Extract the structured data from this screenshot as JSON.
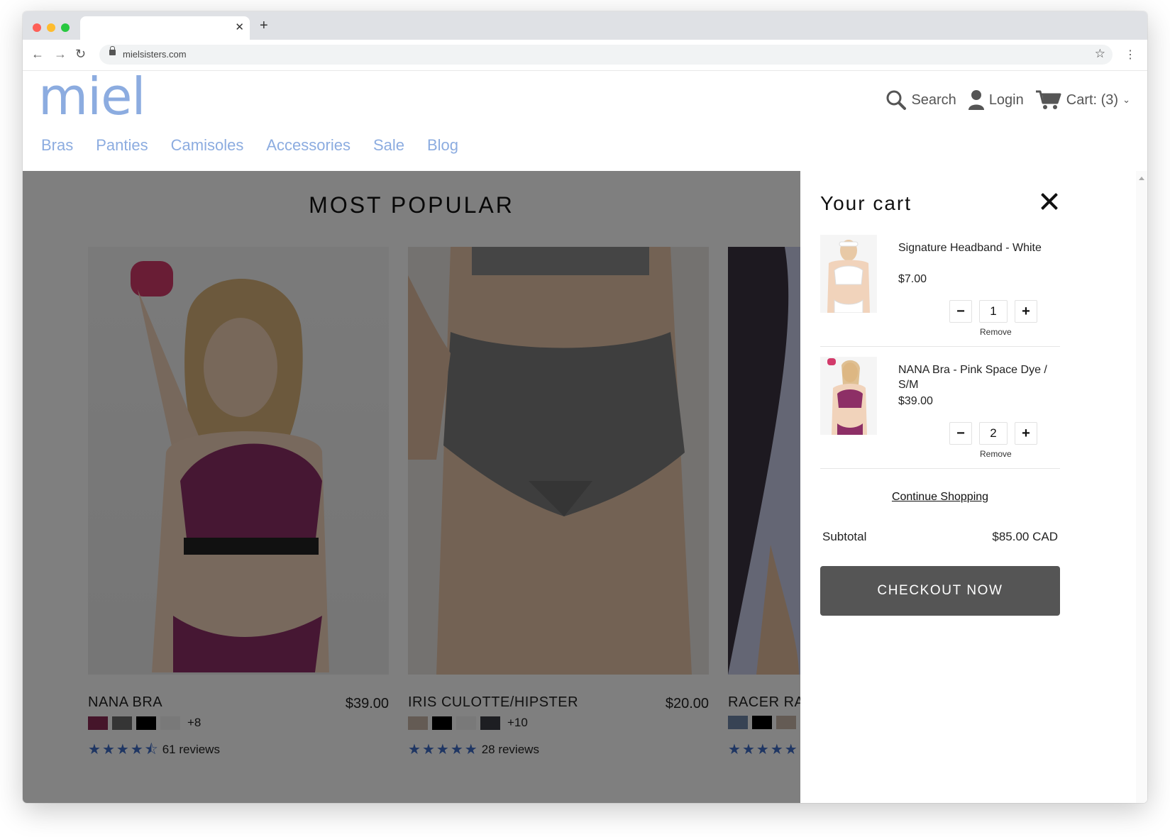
{
  "browser": {
    "url": "mielsisters.com"
  },
  "site": {
    "logo": "miel",
    "nav": [
      "Bras",
      "Panties",
      "Camisoles",
      "Accessories",
      "Sale",
      "Blog"
    ],
    "search_label": "Search",
    "login_label": "Login",
    "cart_label": "Cart: (3)"
  },
  "main": {
    "section_title": "MOST POPULAR",
    "products": [
      {
        "name": "NANA BRA",
        "price": "$39.00",
        "swatches": [
          "#8a2b55",
          "#6b6b6b",
          "#000000",
          "#f3f3f3"
        ],
        "more_colors": "+8",
        "rating": 4.5,
        "reviews": "61 reviews"
      },
      {
        "name": "IRIS CULOTTE/HIPSTER",
        "price": "$20.00",
        "swatches": [
          "#c9b7a8",
          "#000000",
          "#f3f3f3",
          "#3a3d45"
        ],
        "more_colors": "+10",
        "rating": 5,
        "reviews": "28 reviews"
      },
      {
        "name": "RACER RA",
        "price": "",
        "swatches": [
          "#6f86a8",
          "#000000",
          "#c9b7a8"
        ],
        "more_colors": "",
        "rating": 5,
        "reviews": ""
      }
    ]
  },
  "cart": {
    "title": "Your cart",
    "items": [
      {
        "name": "Signature Headband - White",
        "price": "$7.00",
        "qty": "1",
        "minus": "−",
        "plus": "+",
        "remove": "Remove"
      },
      {
        "name": "NANA Bra - Pink Space Dye / S/M",
        "price": "$39.00",
        "qty": "2",
        "minus": "−",
        "plus": "+",
        "remove": "Remove"
      }
    ],
    "continue_label": "Continue Shopping",
    "subtotal_label": "Subtotal",
    "subtotal_value": "$85.00 CAD",
    "checkout_label": "CHECKOUT NOW"
  },
  "colors": {
    "brand": "#8cace0",
    "star": "#3e6cc6",
    "checkout_bg": "#555555"
  }
}
